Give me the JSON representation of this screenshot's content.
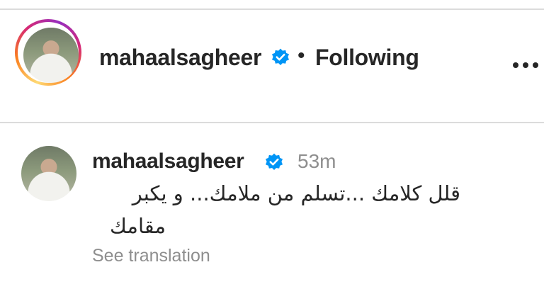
{
  "post_header": {
    "username": "mahaalsagheer",
    "separator": "•",
    "follow_status": "Following",
    "more_icon": "more-horizontal-icon",
    "verified_icon": "verified-badge-icon"
  },
  "comment": {
    "username": "mahaalsagheer",
    "timestamp": "53m",
    "text_line1": "قلل كلامك ...تسلم من ملامك... و يكبر",
    "text_line2": "مقامك",
    "see_translation": "See translation",
    "verified_icon": "verified-badge-icon"
  },
  "colors": {
    "text": "#262626",
    "muted": "#8e8e8e",
    "verified": "#0095f6",
    "divider": "#dbdbdb"
  }
}
